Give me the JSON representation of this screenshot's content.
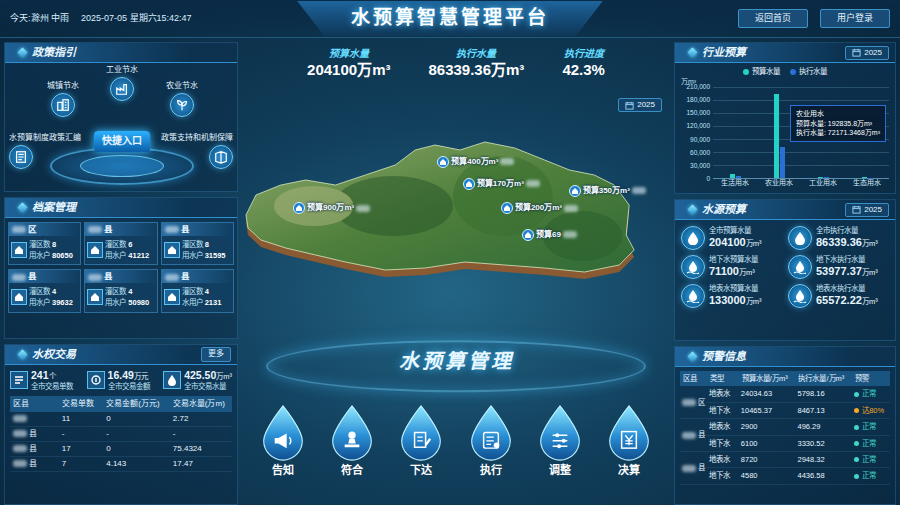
{
  "header": {
    "weather": "今天:滁州 中雨",
    "datetime": "2025-07-05 星期六15:42:47",
    "title": "水预算智慧管理平台",
    "buttons": [
      "返回首页",
      "用户登录"
    ]
  },
  "summary": [
    {
      "label": "预算水量",
      "value": "204100万m³"
    },
    {
      "label": "执行水量",
      "value": "86339.36万m³"
    },
    {
      "label": "执行进度",
      "value": "42.3%"
    }
  ],
  "policy": {
    "title": "政策指引",
    "center": "快捷入口",
    "items": [
      "工业节水",
      "城镇节水",
      "农业节水",
      "水预算制度政策汇编",
      "政策支持和机制保障"
    ]
  },
  "archive": {
    "title": "档案管理",
    "cards": [
      {
        "name": "区",
        "stats": [
          {
            "label": "灌区数",
            "value": "8"
          },
          {
            "label": "用水户",
            "value": "80650"
          }
        ]
      },
      {
        "name": "县",
        "stats": [
          {
            "label": "灌区数",
            "value": "6"
          },
          {
            "label": "用水户",
            "value": "41212"
          }
        ]
      },
      {
        "name": "县",
        "stats": [
          {
            "label": "灌区数",
            "value": "8"
          },
          {
            "label": "用水户",
            "value": "31595"
          }
        ]
      },
      {
        "name": "县",
        "stats": [
          {
            "label": "灌区数",
            "value": "4"
          },
          {
            "label": "用水户",
            "value": "39632"
          }
        ]
      },
      {
        "name": "县",
        "stats": [
          {
            "label": "灌区数",
            "value": "4"
          },
          {
            "label": "用水户",
            "value": "50980"
          }
        ]
      },
      {
        "name": "县",
        "stats": [
          {
            "label": "灌区数",
            "value": "4"
          },
          {
            "label": "水用户",
            "value": "2131"
          }
        ]
      }
    ]
  },
  "trade": {
    "title": "水权交易",
    "more": "更多",
    "stats": [
      {
        "value": "241",
        "unit": "个",
        "label": "全市交易单数"
      },
      {
        "value": "16.49",
        "unit": "万元",
        "label": "全市交易金额"
      },
      {
        "value": "425.50",
        "unit": "万m³",
        "label": "全市交易水量"
      }
    ],
    "columns": [
      "区县",
      "交易单数",
      "交易金额(万元)",
      "交易水量(万m)"
    ],
    "rows": [
      [
        "",
        "11",
        "0",
        "2.72"
      ],
      [
        "县",
        "-",
        "-",
        "-"
      ],
      [
        "县",
        "17",
        "0",
        "75.4324"
      ],
      [
        "县",
        "7",
        "4.143",
        "17.47"
      ]
    ]
  },
  "map": {
    "year": "2025",
    "pins": [
      {
        "label": "预算400万m³"
      },
      {
        "label": "预算900万m³"
      },
      {
        "label": "预算170万m³"
      },
      {
        "label": "预算200万m³"
      },
      {
        "label": "预算69"
      },
      {
        "label": "预算350万m³"
      }
    ]
  },
  "process": {
    "title": "水预算管理",
    "steps": [
      "告知",
      "符合",
      "下达",
      "执行",
      "调整",
      "决算"
    ]
  },
  "industry": {
    "title": "行业预算",
    "year": "2025",
    "unit": "万m³",
    "ticks": [
      "210,000",
      "180,000",
      "150,000",
      "120,000",
      "90,000",
      "60,000",
      "30,000",
      "0"
    ],
    "categories": [
      "生活用水",
      "农业用水",
      "工业用水",
      "生态用水"
    ],
    "series": [
      {
        "name": "预算水量",
        "color": "#25d3c6",
        "values": [
          9000,
          192835.8,
          2500,
          1800
        ]
      },
      {
        "name": "执行水量",
        "color": "#2b6fd6",
        "values": [
          4500,
          72171.3468,
          1200,
          800
        ]
      }
    ],
    "tooltip": {
      "title": "农业用水",
      "lines": [
        "预算水量: 192835.8万m³",
        "执行水量: 72171.3468万m³"
      ]
    }
  },
  "source": {
    "title": "水源预算",
    "year": "2025",
    "items": [
      {
        "label": "全市预算水量",
        "value": "204100",
        "unit": "万m³"
      },
      {
        "label": "全市执行水量",
        "value": "86339.36",
        "unit": "万m³"
      },
      {
        "label": "地下水预算水量",
        "value": "71100",
        "unit": "万m³"
      },
      {
        "label": "地下水执行水量",
        "value": "53977.37",
        "unit": "万m³"
      },
      {
        "label": "地表水预算水量",
        "value": "133000",
        "unit": "万m³"
      },
      {
        "label": "地表水执行水量",
        "value": "65572.22",
        "unit": "万m³"
      }
    ]
  },
  "warning": {
    "title": "预警信息",
    "columns": [
      "区县",
      "类型",
      "预算水量/万m³",
      "执行水量/万m³",
      "预警"
    ],
    "groups": [
      {
        "district": "区",
        "rows": [
          {
            "type": "地表水",
            "budget": "24034.63",
            "executed": "5798.16",
            "status": "正常",
            "color": "#3fd7c8"
          },
          {
            "type": "地下水",
            "budget": "10465.37",
            "executed": "8467.13",
            "status": "达80%",
            "color": "#f5a623"
          }
        ]
      },
      {
        "district": "县",
        "rows": [
          {
            "type": "地表水",
            "budget": "2900",
            "executed": "496.29",
            "status": "正常",
            "color": "#3fd7c8"
          },
          {
            "type": "地下水",
            "budget": "6100",
            "executed": "3330.52",
            "status": "正常",
            "color": "#3fd7c8"
          }
        ]
      },
      {
        "district": "县",
        "rows": [
          {
            "type": "地表水",
            "budget": "8720",
            "executed": "2948.32",
            "status": "正常",
            "color": "#3fd7c8"
          },
          {
            "type": "地下水",
            "budget": "4580",
            "executed": "4436.58",
            "status": "正常",
            "color": "#3fd7c8"
          }
        ]
      }
    ]
  }
}
